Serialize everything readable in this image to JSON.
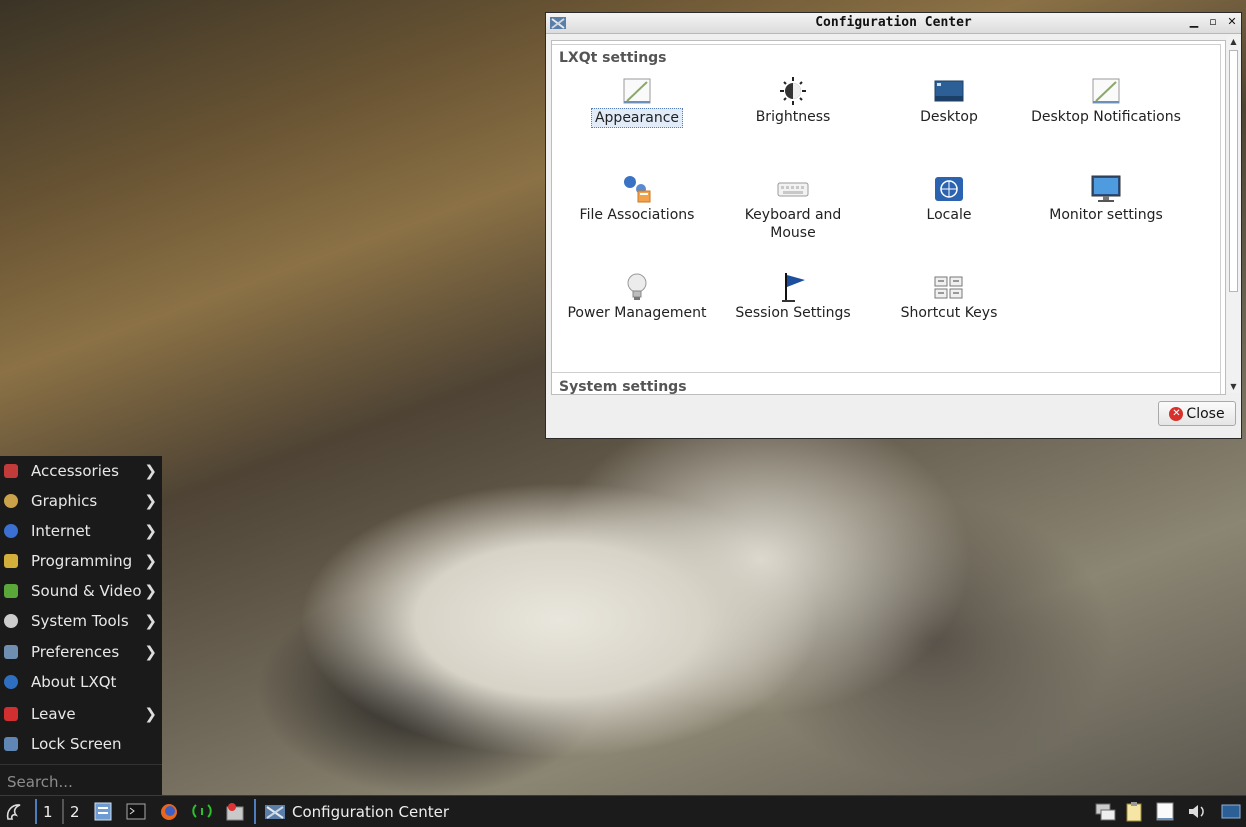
{
  "window": {
    "title": "Configuration Center",
    "sections": [
      {
        "title": "LXQt settings"
      },
      {
        "title": "System settings"
      }
    ],
    "items": [
      {
        "label": "Appearance",
        "icon": "appearance-icon",
        "selected": true
      },
      {
        "label": "Brightness",
        "icon": "brightness-icon"
      },
      {
        "label": "Desktop",
        "icon": "desktop-icon"
      },
      {
        "label": "Desktop Notifications",
        "icon": "notifications-icon"
      },
      {
        "label": "File Associations",
        "icon": "file-associations-icon"
      },
      {
        "label": "Keyboard and Mouse",
        "icon": "keyboard-icon"
      },
      {
        "label": "Locale",
        "icon": "locale-icon"
      },
      {
        "label": "Monitor settings",
        "icon": "monitor-icon"
      },
      {
        "label": "Power Management",
        "icon": "lightbulb-icon"
      },
      {
        "label": "Session Settings",
        "icon": "flag-icon"
      },
      {
        "label": "Shortcut Keys",
        "icon": "shortcut-keys-icon"
      }
    ],
    "close_label": "Close"
  },
  "menu": {
    "items": [
      {
        "label": "Accessories",
        "icon": "accessories-icon",
        "submenu": true,
        "color": "#c23b3b"
      },
      {
        "label": "Graphics",
        "icon": "palette-icon",
        "submenu": true,
        "color": "#c9a24a"
      },
      {
        "label": "Internet",
        "icon": "globe-icon",
        "submenu": true,
        "color": "#3b6fd1"
      },
      {
        "label": "Programming",
        "icon": "hammer-icon",
        "submenu": true,
        "color": "#d2b03b"
      },
      {
        "label": "Sound & Video",
        "icon": "media-icon",
        "submenu": true,
        "color": "#5aa83a"
      },
      {
        "label": "System Tools",
        "icon": "gear-icon",
        "submenu": true,
        "color": "#cccccc"
      },
      {
        "label": "Preferences",
        "icon": "preferences-icon",
        "submenu": true,
        "color": "#6f8fb2"
      },
      {
        "label": "About LXQt",
        "icon": "info-icon",
        "submenu": false,
        "color": "#2f6fc2"
      },
      {
        "label": "Leave",
        "icon": "power-icon",
        "submenu": true,
        "color": "#d23030"
      },
      {
        "label": "Lock Screen",
        "icon": "lock-screen-icon",
        "submenu": false,
        "color": "#5f86b5"
      }
    ],
    "search_placeholder": "Search..."
  },
  "taskbar": {
    "desktops": [
      "1",
      "2"
    ],
    "task_label": "Configuration Center"
  }
}
